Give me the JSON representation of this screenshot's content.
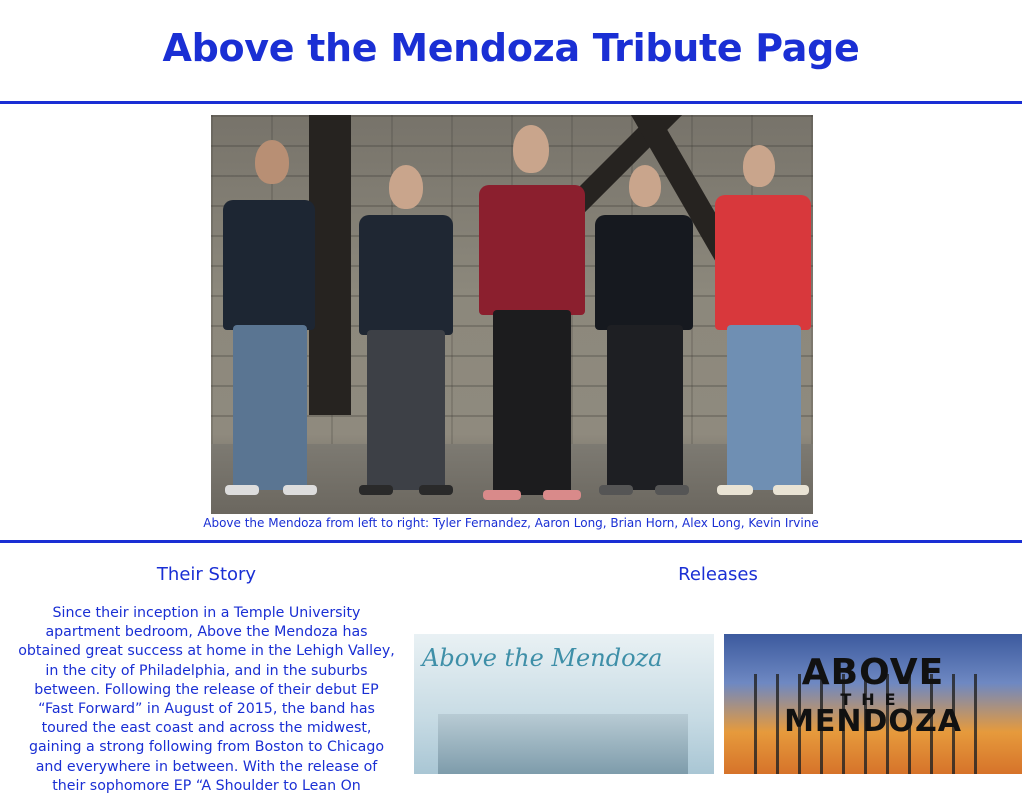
{
  "header": {
    "title": "Above the Mendoza Tribute Page"
  },
  "hero": {
    "caption": "Above the Mendoza from left to right: Tyler Fernandez, Aaron Long, Brian Horn, Alex Long, Kevin Irvine"
  },
  "story": {
    "heading": "Their Story",
    "text": "Since their inception in a Temple University apartment bedroom, Above the Mendoza has obtained great success at home in the Lehigh Valley, in the city of Philadelphia, and in the suburbs between. Following the release of their debut EP “Fast Forward” in August of 2015, the band has toured the east coast and across the midwest, gaining a strong following from Boston to Chicago and everywhere in between. With the release of their sophomore EP “A Shoulder to Lean On"
  },
  "releases": {
    "heading": "Releases",
    "albums": [
      {
        "cover_text": "Above the Mendoza"
      },
      {
        "cover_line1": "ABOVE",
        "cover_line2": "THE",
        "cover_line3": "MENDOZA"
      }
    ]
  },
  "colors": {
    "accent": "#1a2fd4",
    "background": "#ffffff"
  }
}
